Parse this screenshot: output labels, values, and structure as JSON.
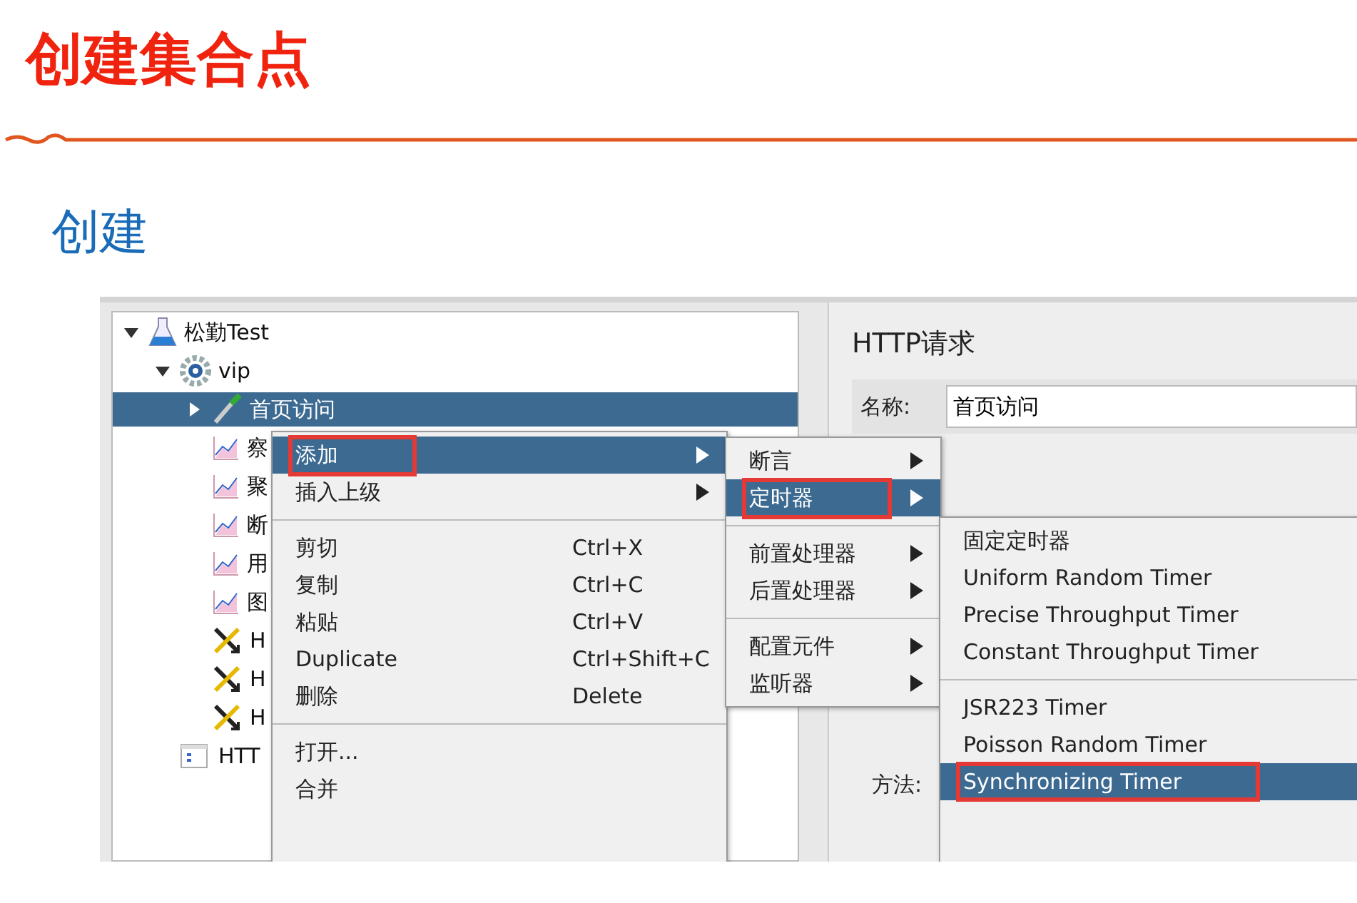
{
  "slide": {
    "title": "创建集合点",
    "subtitle": "创建"
  },
  "tree": {
    "items": [
      {
        "label": "松勤Test",
        "kind": "plan",
        "expanded": true,
        "selected": false,
        "children": [
          {
            "label": "vip",
            "kind": "group",
            "expanded": true,
            "selected": false,
            "children": [
              {
                "label": "首页访问",
                "kind": "sampler",
                "expanded": false,
                "selected": true
              },
              {
                "label": "察",
                "kind": "listener",
                "selected": false
              },
              {
                "label": "聚",
                "kind": "listener",
                "selected": false
              },
              {
                "label": "断",
                "kind": "listener",
                "selected": false
              },
              {
                "label": "用",
                "kind": "listener",
                "selected": false
              },
              {
                "label": "图",
                "kind": "listener",
                "selected": false
              },
              {
                "label": "H",
                "kind": "tool",
                "selected": false
              },
              {
                "label": "H",
                "kind": "tool",
                "selected": false
              },
              {
                "label": "H",
                "kind": "tool",
                "selected": false
              }
            ]
          },
          {
            "label": "HTT",
            "kind": "element",
            "selected": false
          }
        ]
      }
    ]
  },
  "panel": {
    "title": "HTTP请求",
    "name_label": "名称:",
    "name_value": "首页访问",
    "method_label": "方法:"
  },
  "context_menu": [
    {
      "kind": "item",
      "label": "添加",
      "submenu": true,
      "selected": true,
      "highlighted": true
    },
    {
      "kind": "item",
      "label": "插入上级",
      "submenu": true,
      "selected": false,
      "highlighted": false
    },
    {
      "kind": "separator"
    },
    {
      "kind": "item",
      "label": "剪切",
      "shortcut": "Ctrl+X",
      "selected": false,
      "highlighted": false
    },
    {
      "kind": "item",
      "label": "复制",
      "shortcut": "Ctrl+C",
      "selected": false,
      "highlighted": false
    },
    {
      "kind": "item",
      "label": "粘贴",
      "shortcut": "Ctrl+V",
      "selected": false,
      "highlighted": false
    },
    {
      "kind": "item",
      "label": "Duplicate",
      "shortcut": "Ctrl+Shift+C",
      "selected": false,
      "highlighted": false
    },
    {
      "kind": "item",
      "label": "删除",
      "shortcut": "Delete",
      "selected": false,
      "highlighted": false
    },
    {
      "kind": "separator"
    },
    {
      "kind": "item",
      "label": "打开...",
      "selected": false,
      "highlighted": false
    },
    {
      "kind": "item",
      "label": "合并",
      "selected": false,
      "highlighted": false
    }
  ],
  "add_submenu": [
    {
      "kind": "item",
      "label": "断言",
      "submenu": true,
      "selected": false,
      "highlighted": false
    },
    {
      "kind": "item",
      "label": "定时器",
      "submenu": true,
      "selected": true,
      "highlighted": true
    },
    {
      "kind": "separator"
    },
    {
      "kind": "item",
      "label": "前置处理器",
      "submenu": true,
      "selected": false,
      "highlighted": false
    },
    {
      "kind": "item",
      "label": "后置处理器",
      "submenu": true,
      "selected": false,
      "highlighted": false
    },
    {
      "kind": "separator"
    },
    {
      "kind": "item",
      "label": "配置元件",
      "submenu": true,
      "selected": false,
      "highlighted": false
    },
    {
      "kind": "item",
      "label": "监听器",
      "submenu": true,
      "selected": false,
      "highlighted": false
    }
  ],
  "timer_submenu": [
    {
      "kind": "item",
      "label": "固定定时器",
      "selected": false,
      "highlighted": false
    },
    {
      "kind": "item",
      "label": "Uniform Random Timer",
      "selected": false,
      "highlighted": false
    },
    {
      "kind": "item",
      "label": "Precise Throughput Timer",
      "selected": false,
      "highlighted": false
    },
    {
      "kind": "item",
      "label": "Constant Throughput Timer",
      "selected": false,
      "highlighted": false
    },
    {
      "kind": "separator"
    },
    {
      "kind": "item",
      "label": "JSR223 Timer",
      "selected": false,
      "highlighted": false
    },
    {
      "kind": "item",
      "label": "Poisson Random Timer",
      "selected": false,
      "highlighted": false
    },
    {
      "kind": "item",
      "label": "Synchronizing Timer",
      "selected": true,
      "highlighted": true
    }
  ]
}
